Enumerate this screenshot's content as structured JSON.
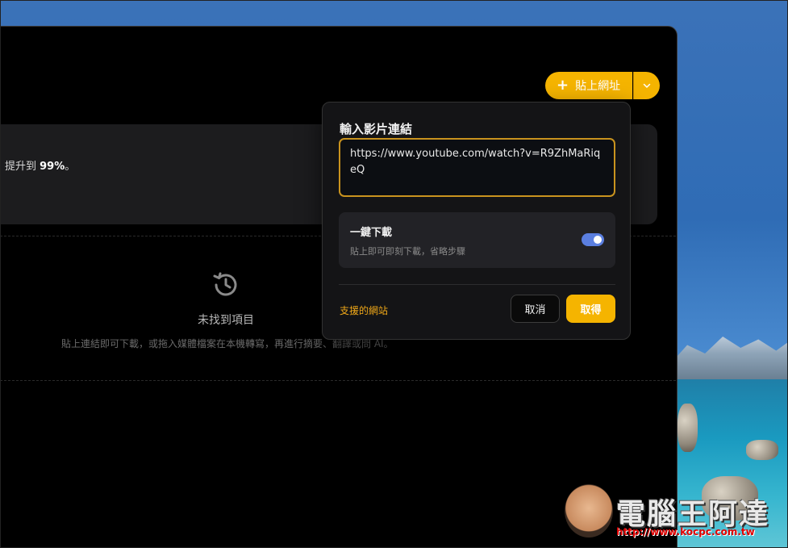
{
  "toolbar": {
    "paste_url_label": "貼上網址"
  },
  "banner": {
    "text_prefix": "提升到 ",
    "highlight": "99%",
    "text_suffix": "。"
  },
  "empty_state": {
    "title": "未找到項目",
    "description": "貼上連結即可下載，或拖入媒體檔案在本機轉寫，再進行摘要、翻譯或問 AI。"
  },
  "popover": {
    "title": "輸入影片連結",
    "url_value": "https://www.youtube.com/watch?v=R9ZhMaRiqeQ",
    "one_click": {
      "title": "一鍵下載",
      "description": "貼上即可即刻下載，省略步驟",
      "enabled": true
    },
    "supported_sites_label": "支援的網站",
    "cancel_label": "取消",
    "get_label": "取得"
  },
  "watermark": {
    "text": "電腦王阿達",
    "url": "http://www.kocpc.com.tw"
  },
  "colors": {
    "accent": "#f5b400",
    "toggle_on": "#5b7fe0",
    "link": "#f0a818"
  }
}
